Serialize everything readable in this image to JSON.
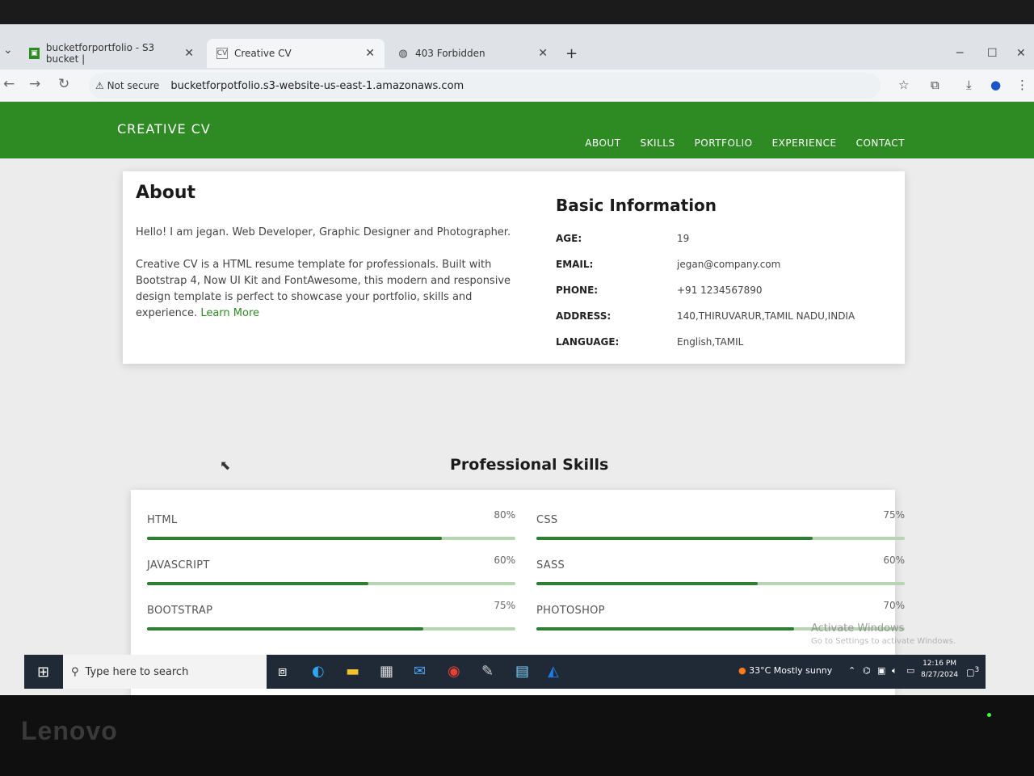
{
  "browser": {
    "tabs": [
      {
        "title": "bucketforportfolio - S3 bucket |",
        "icon": "s3-icon"
      },
      {
        "title": "Creative CV",
        "icon": "cv-icon"
      },
      {
        "title": "403 Forbidden",
        "icon": "globe-icon"
      }
    ],
    "security_label": "Not secure",
    "url": "bucketforpotfolio.s3-website-us-east-1.amazonaws.com"
  },
  "site": {
    "brand": "CREATIVE CV",
    "menu": [
      "ABOUT",
      "SKILLS",
      "PORTFOLIO",
      "EXPERIENCE",
      "CONTACT"
    ],
    "accent_color": "#2e8b24",
    "about": {
      "title": "About",
      "intro": "Hello! I am jegan. Web Developer, Graphic Designer and Photographer.",
      "description": "Creative CV is a HTML resume template for professionals. Built with Bootstrap 4, Now UI Kit and FontAwesome, this modern and responsive design template is perfect to showcase your portfolio, skills and experience.",
      "learn_more": "Learn More"
    },
    "basic_info": {
      "title": "Basic Information",
      "rows": [
        {
          "label": "AGE:",
          "value": "19"
        },
        {
          "label": "EMAIL:",
          "value": "jegan@company.com"
        },
        {
          "label": "PHONE:",
          "value": "+91 1234567890"
        },
        {
          "label": "ADDRESS:",
          "value": "140,THIRUVARUR,TAMIL NADU,INDIA"
        },
        {
          "label": "LANGUAGE:",
          "value": "English,TAMIL"
        }
      ]
    },
    "skills": {
      "title": "Professional Skills",
      "items": [
        {
          "name": "HTML",
          "percent": "80%",
          "level": 80
        },
        {
          "name": "CSS",
          "percent": "75%",
          "level": 75
        },
        {
          "name": "JAVASCRIPT",
          "percent": "60%",
          "level": 60
        },
        {
          "name": "SASS",
          "percent": "60%",
          "level": 60
        },
        {
          "name": "BOOTSTRAP",
          "percent": "75%",
          "level": 75
        },
        {
          "name": "PHOTOSHOP",
          "percent": "70%",
          "level": 70
        }
      ]
    }
  },
  "windows": {
    "watermark_title": "Activate Windows",
    "watermark_sub": "Go to Settings to activate Windows.",
    "search_placeholder": "Type here to search",
    "weather": "33°C  Mostly sunny",
    "time": "12:16 PM",
    "date": "8/27/2024",
    "notifications": "3"
  },
  "hardware": {
    "brand": "Lenovo"
  }
}
